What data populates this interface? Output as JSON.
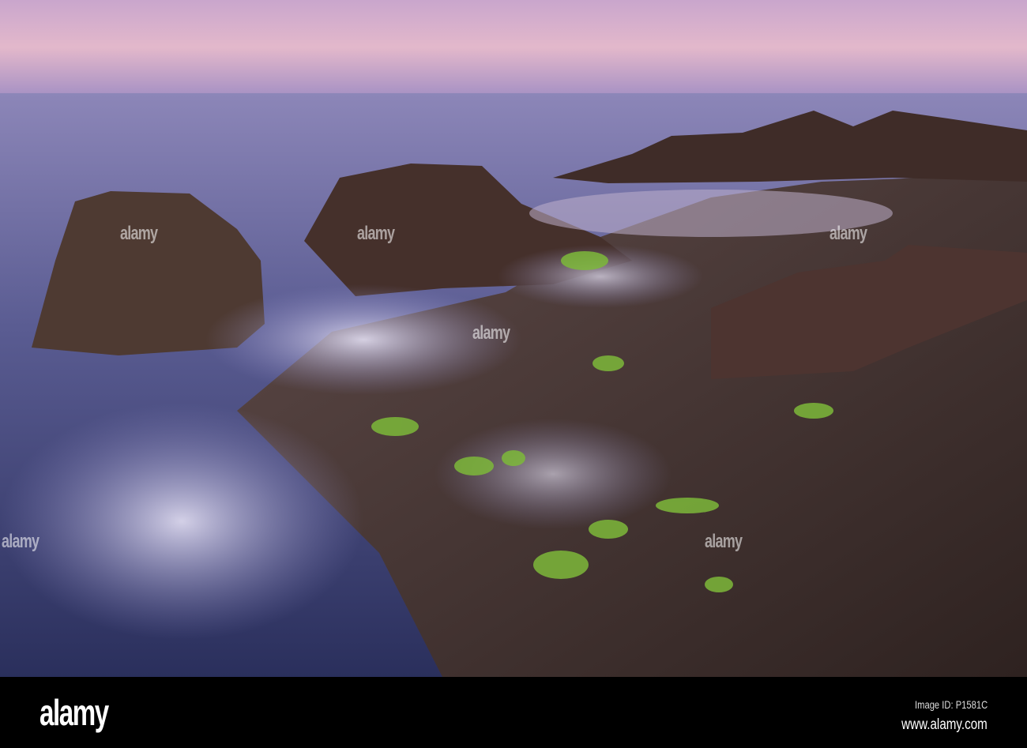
{
  "photo": {
    "subject": "Long-exposure seascape with rocks and green algae at dusk",
    "colors": {
      "sky_top": "#d9b5cf",
      "sky_horizon": "#b69ac8",
      "sea": "#6a6a9e",
      "rock": "#4a3430",
      "algae": "#7db83a"
    }
  },
  "watermark": {
    "text": "alamy"
  },
  "footer": {
    "logo": "alamy",
    "image_id": "Image ID: P1581C",
    "website": "www.alamy.com"
  }
}
